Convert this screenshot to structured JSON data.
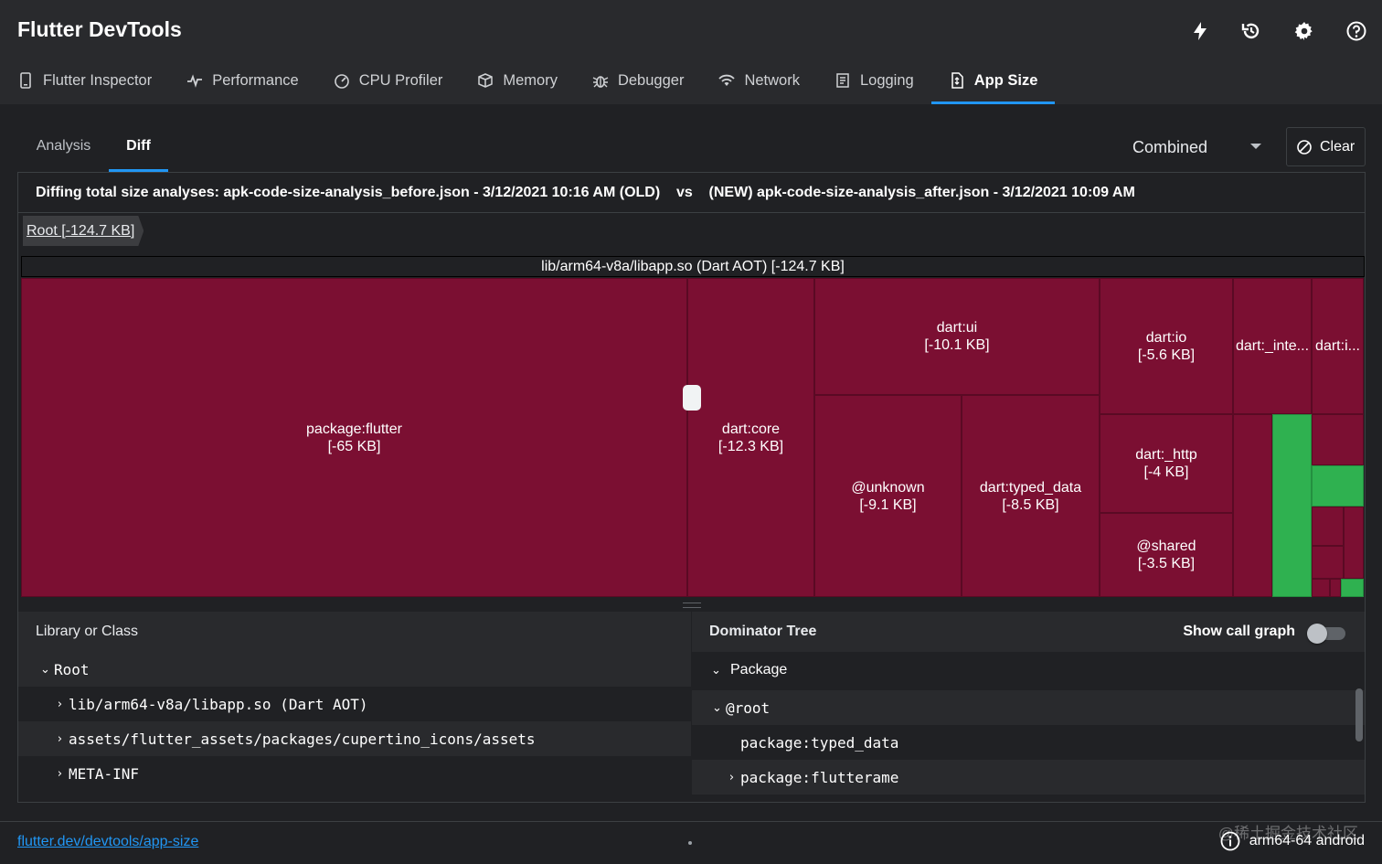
{
  "app": {
    "title": "Flutter DevTools",
    "actions": [
      "hot-reload-icon",
      "hot-restart-icon",
      "settings-icon",
      "help-icon"
    ]
  },
  "tabs": [
    {
      "label": "Flutter Inspector",
      "icon": "phone-icon"
    },
    {
      "label": "Performance",
      "icon": "pulse-icon"
    },
    {
      "label": "CPU Profiler",
      "icon": "gauge-icon"
    },
    {
      "label": "Memory",
      "icon": "memory-icon"
    },
    {
      "label": "Debugger",
      "icon": "bug-icon"
    },
    {
      "label": "Network",
      "icon": "wifi-icon"
    },
    {
      "label": "Logging",
      "icon": "log-icon"
    },
    {
      "label": "App Size",
      "icon": "file-icon",
      "active": true
    }
  ],
  "subtabs": {
    "analysis": "Analysis",
    "diff": "Diff",
    "active": "Diff"
  },
  "mode_select": {
    "value": "Combined"
  },
  "clear_label": "Clear",
  "diff": {
    "old_file": "apk-code-size-analysis_before.json - 3/12/2021 10:16 AM (OLD)",
    "vs": "vs",
    "new_file": "(NEW) apk-code-size-analysis_after.json - 3/12/2021 10:09 AM",
    "header": "Diffing total size analyses: apk-code-size-analysis_before.json - 3/12/2021 10:16 AM (OLD)    vs    (NEW) apk-code-size-analysis_after.json - 3/12/2021 10:09 AM"
  },
  "breadcrumb": "Root [-124.7 KB]",
  "treemap": {
    "root_label": "lib/arm64-v8a/libapp.so (Dart AOT) [-124.7 KB]",
    "colors": {
      "decrease": "#7b0f32",
      "increase": "#2fb150"
    },
    "nodes": [
      {
        "name": "package:flutter",
        "size": "[-65 KB]"
      },
      {
        "name": "dart:core",
        "size": "[-12.3 KB]"
      },
      {
        "name": "dart:ui",
        "size": "[-10.1 KB]"
      },
      {
        "name": "dart:io",
        "size": "[-5.6 KB]"
      },
      {
        "name": "dart:_inte...",
        "size": ""
      },
      {
        "name": "dart:i...",
        "size": ""
      },
      {
        "name": "@unknown",
        "size": "[-9.1 KB]"
      },
      {
        "name": "dart:typed_data",
        "size": "[-8.5 KB]"
      },
      {
        "name": "dart:_http",
        "size": "[-4 KB]"
      },
      {
        "name": "@shared",
        "size": "[-3.5 KB]"
      }
    ]
  },
  "library_table": {
    "header": "Library or Class",
    "rows": [
      {
        "label": "Root",
        "expanded": true,
        "depth": 0
      },
      {
        "label": "lib/arm64-v8a/libapp.so (Dart AOT)",
        "expanded": false,
        "depth": 1
      },
      {
        "label": "assets/flutter_assets/packages/cupertino_icons/assets",
        "expanded": false,
        "depth": 1
      },
      {
        "label": "META-INF",
        "expanded": false,
        "depth": 1
      }
    ]
  },
  "dominator_tree": {
    "header": "Dominator Tree",
    "show_call_graph_label": "Show call graph",
    "show_call_graph": false,
    "package_label": "Package",
    "rows": [
      {
        "label": "@root",
        "expanded": true,
        "depth": 0
      },
      {
        "label": "package:typed_data",
        "expanded": null,
        "depth": 1
      },
      {
        "label": "package:flutterame",
        "expanded": false,
        "depth": 1
      }
    ]
  },
  "status": {
    "docs_link": "flutter.dev/devtools/app-size",
    "device": "arm64-64 android",
    "watermark": "@稀土掘金技术社区"
  }
}
